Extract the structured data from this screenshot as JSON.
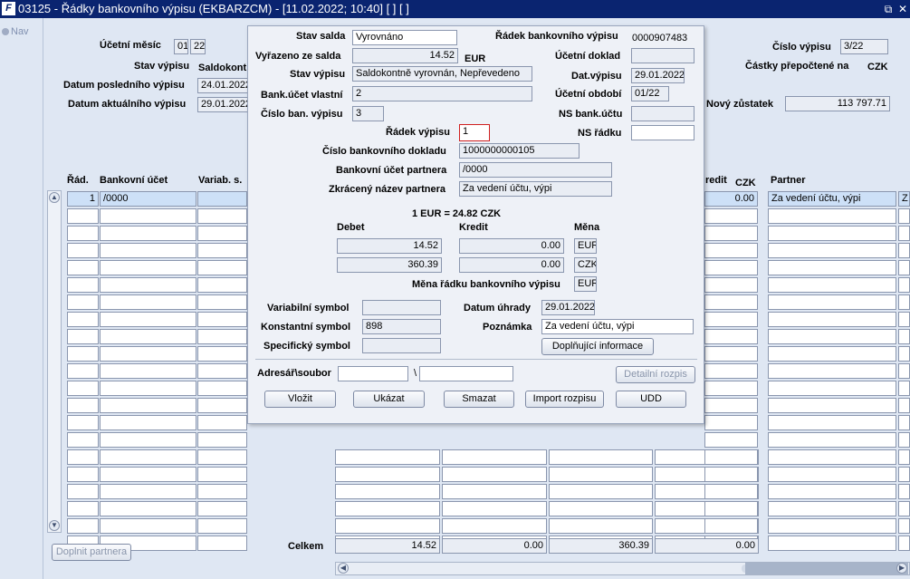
{
  "window": {
    "title": "03125 - Řádky bankovního výpisu (EKBARZCM) - [11.02.2022; 10:40]  [ ]  [ ]",
    "logo": "F",
    "restore_icon": "⧉",
    "close_icon": "✕"
  },
  "nav": {
    "label": "Nav"
  },
  "header": {
    "ucetni_mesic_label": "Účetní měsíc",
    "ucetni_mesic_month": "01",
    "ucetni_mesic_year": "22",
    "stav_vypisu_label": "Stav výpisu",
    "stav_vypisu_value": "Saldokont",
    "datum_posledniho_label": "Datum posledního výpisu",
    "datum_posledniho_value": "24.01.2022",
    "datum_aktualniho_label": "Datum aktuálního výpisu",
    "datum_aktualniho_value": "29.01.2022",
    "cislo_vypisu_label": "Číslo výpisu",
    "cislo_vypisu_value": "3/22",
    "castky_label": "Částky  přepočtené na",
    "castky_currency": "CZK",
    "novy_zustatek_label": "Nový zůstatek",
    "novy_zustatek_value": "113 797.71"
  },
  "grid": {
    "col_rad": "Řád.",
    "col_ucet": "Bankovní účet",
    "col_variab": "Variab. s.",
    "col_kredit": "redit",
    "col_czk": "CZK",
    "col_partner": "Partner",
    "row1": {
      "rad": "1",
      "ucet": "/0000",
      "kredit": "0.00",
      "partner": "Za vedení účtu, výpi",
      "extra": "Z"
    },
    "celkem_label": "Celkem",
    "celkem_debet": "14.52",
    "celkem_kredit": "0.00",
    "celkem_debet_czk": "360.39",
    "celkem_kredit_czk": "0.00",
    "doplnit_button": "Doplnit partnera"
  },
  "dialog": {
    "stav_salda_label": "Stav salda",
    "stav_salda_value": "Vyrovnáno",
    "radek_bv_label": "Řádek bankovního výpisu",
    "radek_bv_value": "0000907483",
    "vyrazeno_label": "Vyřazeno ze salda",
    "vyrazeno_value": "14.52",
    "vyrazeno_currency": "EUR",
    "ucetni_doklad_label": "Účetní doklad",
    "ucetni_doklad_value": "",
    "stav_vypisu_label": "Stav výpisu",
    "stav_vypisu_value": "Saldokontně vyrovnán, Nepřevedeno",
    "dat_vypisu_label": "Dat.výpisu",
    "dat_vypisu_value": "29.01.2022",
    "bank_ucet_label": "Bank.účet vlastní",
    "bank_ucet_value": "2",
    "ucetni_obdobi_label": "Účetní období",
    "ucetni_obdobi_value": "01/22",
    "cislo_ban_label": "Číslo ban. výpisu",
    "cislo_ban_value": "3",
    "ns_bank_label": "NS bank.účtu",
    "ns_bank_value": "",
    "radek_vypisu_label": "Řádek výpisu",
    "radek_vypisu_value": "1",
    "ns_radku_label": "NS řádku",
    "ns_radku_value": "",
    "cislo_dokladu_label": "Číslo bankovního dokladu",
    "cislo_dokladu_value": "1000000000105",
    "ucet_partnera_label": "Bankovní účet partnera",
    "ucet_partnera_value": "/0000",
    "nazev_partnera_label": "Zkrácený název partnera",
    "nazev_partnera_value": "Za vedení účtu, výpi",
    "kurz": "1 EUR = 24.82 CZK",
    "debet_label": "Debet",
    "kredit_label": "Kredit",
    "mena_label": "Měna",
    "debet_eur": "14.52",
    "kredit_eur": "0.00",
    "mena_eur": "EUR",
    "debet_czk": "360.39",
    "kredit_czk": "0.00",
    "mena_czk": "CZK",
    "mena_radku_label": "Měna řádku bankovního výpisu",
    "mena_radku_value": "EUR",
    "variabilni_label": "Variabilní symbol",
    "variabilni_value": "",
    "datum_uhrady_label": "Datum úhrady",
    "datum_uhrady_value": "29.01.2022",
    "konstantni_label": "Konstantní symbol",
    "konstantni_value": "898",
    "poznamka_label": "Poznámka",
    "poznamka_value": "Za vedení účtu, výpi",
    "specificky_label": "Specifický symbol",
    "specificky_value": "",
    "doplnujici_button": "Doplňující informace",
    "adresar_label": "Adresář\\soubor",
    "adresar_value": "",
    "backslash": "\\",
    "soubor_value": "",
    "detailni_button": "Detailní rozpis",
    "vlozit_button": "Vložit",
    "ukazat_button": "Ukázat",
    "smazat_button": "Smazat",
    "import_button": "Import rozpisu",
    "udd_button": "UDD"
  }
}
